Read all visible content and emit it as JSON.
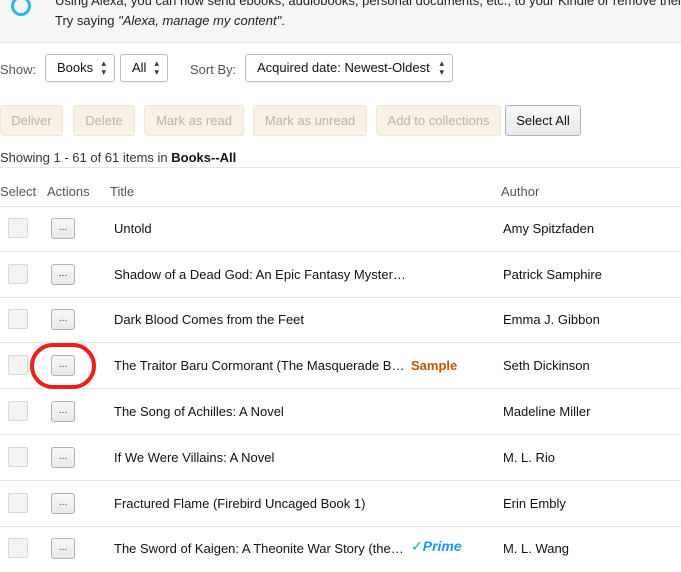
{
  "banner": {
    "line1": "Using Alexa, you can now send ebooks, audiobooks, personal documents, etc., to your Kindle or remove them",
    "line2_prefix": "Try saying ",
    "line2_quote": "\"Alexa, manage my content\"",
    "line2_suffix": "."
  },
  "filters": {
    "show_label": "Show:",
    "type_select": "Books",
    "scope_select": "All",
    "sort_label": "Sort By:",
    "sort_select": "Acquired date: Newest-Oldest"
  },
  "toolbar": {
    "deliver": "Deliver",
    "delete": "Delete",
    "mark_read": "Mark as read",
    "mark_unread": "Mark as unread",
    "add_collections": "Add to collections",
    "select_all": "Select All"
  },
  "summary": {
    "prefix": "Showing 1 - 61 of 61 items in ",
    "category": "Books--All"
  },
  "columns": {
    "select": "Select",
    "actions": "Actions",
    "title": "Title",
    "author": "Author"
  },
  "rows": [
    {
      "actions_label": "...",
      "title": "Untold",
      "badge": "",
      "author": "Amy Spitzfaden"
    },
    {
      "actions_label": "...",
      "title": "Shadow of a Dead God: An Epic Fantasy Myster…",
      "badge": "",
      "author": "Patrick Samphire"
    },
    {
      "actions_label": "...",
      "title": "Dark Blood Comes from the Feet",
      "badge": "",
      "author": "Emma J. Gibbon"
    },
    {
      "actions_label": "...",
      "title": "The Traitor Baru Cormorant (The Masquerade B…",
      "badge": "Sample",
      "author": "Seth Dickinson"
    },
    {
      "actions_label": "...",
      "title": "The Song of Achilles: A Novel",
      "badge": "",
      "author": "Madeline Miller"
    },
    {
      "actions_label": "...",
      "title": "If We Were Villains: A Novel",
      "badge": "",
      "author": "M. L. Rio"
    },
    {
      "actions_label": "...",
      "title": "Fractured Flame (Firebird Uncaged Book 1)",
      "badge": "",
      "author": "Erin Embly"
    },
    {
      "actions_label": "...",
      "title": "The Sword of Kaigen: A Theonite War Story (the…",
      "badge": "✓Prime",
      "author": "M. L. Wang"
    }
  ],
  "colors": {
    "accent_sample": "#c45500",
    "prime_blue": "#1a98ff",
    "highlight_ring": "#ef1f17",
    "alexa_ring": "#2bb7e6"
  }
}
